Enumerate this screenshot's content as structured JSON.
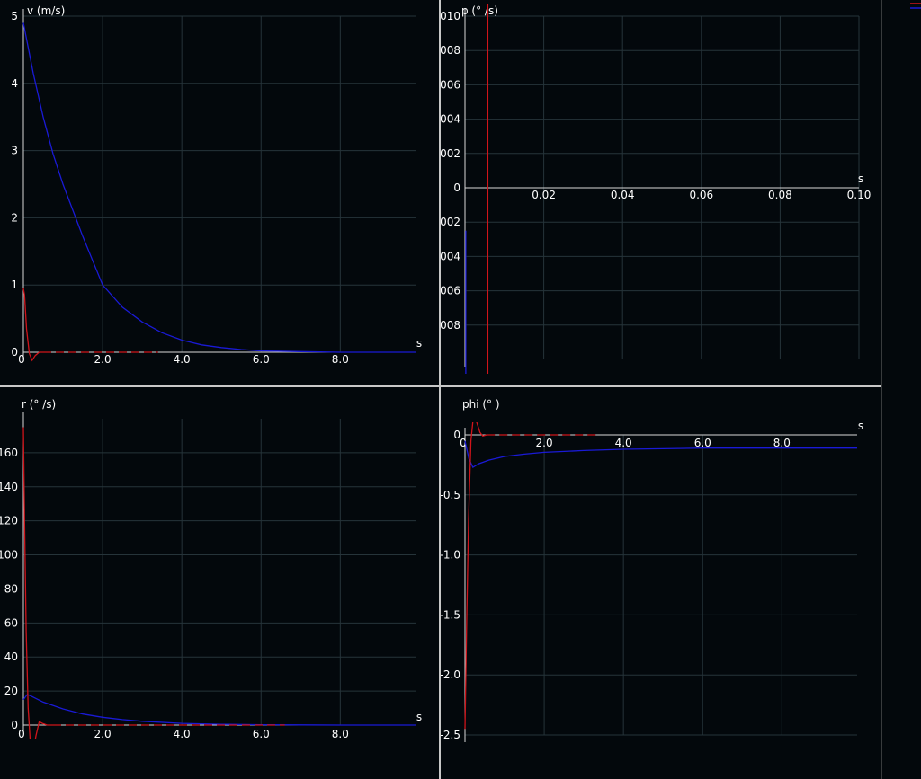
{
  "colors": {
    "background": "#03080c",
    "grid": "#26343a",
    "axis": "#d8d8d8",
    "divider": "#c8c8c8",
    "label": "#ffffff",
    "series_red": "#d0141a",
    "series_blue": "#1a1ad6"
  },
  "chart_data": [
    {
      "type": "line",
      "ylabel": "v (m/s)",
      "xlabel": "s",
      "xlim": [
        0,
        9.9
      ],
      "ylim": [
        0,
        5
      ],
      "xticks": [
        0,
        2,
        4,
        6,
        8
      ],
      "xtick_labels": [
        "0",
        "2.0",
        "4.0",
        "6.0",
        "8.0"
      ],
      "yticks": [
        0,
        1,
        2,
        3,
        4,
        5
      ],
      "ytick_labels": [
        "0",
        "1",
        "2",
        "3",
        "4",
        "5"
      ],
      "grid": true,
      "series": [
        {
          "color": "#1a1ad6",
          "style": "solid",
          "x": [
            0,
            0.25,
            0.5,
            0.75,
            1,
            1.5,
            2,
            2.5,
            3,
            3.5,
            4,
            4.5,
            5,
            5.5,
            6,
            7,
            8,
            9,
            9.9
          ],
          "y": [
            4.9,
            4.15,
            3.5,
            2.95,
            2.5,
            1.72,
            1.0,
            0.67,
            0.45,
            0.29,
            0.18,
            0.11,
            0.07,
            0.04,
            0.02,
            0.01,
            0.0,
            0.0,
            0.0
          ]
        },
        {
          "color": "#d0141a",
          "style": "solid",
          "x": [
            0,
            0.03,
            0.08,
            0.15,
            0.22,
            0.3,
            0.4,
            0.5
          ],
          "y": [
            0.95,
            0.85,
            0.35,
            -0.02,
            -0.12,
            -0.05,
            0.0,
            0.0
          ]
        },
        {
          "color": "#d0141a",
          "style": "dashed",
          "x": [
            0.5,
            3.4
          ],
          "y": [
            0.0,
            0.0
          ]
        }
      ]
    },
    {
      "type": "line",
      "ylabel": "p (° /s)",
      "xlabel": "s",
      "xlim": [
        0,
        0.1
      ],
      "ylim": [
        -0.01,
        0.01
      ],
      "xticks": [
        0.02,
        0.04,
        0.06,
        0.08,
        0.1
      ],
      "xtick_labels": [
        "0.02",
        "0.04",
        "0.06",
        "0.08",
        "0.10"
      ],
      "yticks": [
        0.01,
        0.008,
        0.006,
        0.004,
        0.002,
        0,
        -0.002,
        -0.004,
        -0.006,
        -0.008
      ],
      "ytick_labels": [
        "010",
        "008",
        "006",
        "004",
        "002",
        "0",
        "002",
        "004",
        "006",
        "008"
      ],
      "grid": true,
      "series": [
        {
          "color": "#d0141a",
          "style": "solid",
          "x": [
            0.0058,
            0.0058
          ],
          "y": [
            0.011,
            -0.0115
          ]
        },
        {
          "color": "#1a1ad6",
          "style": "solid",
          "x": [
            0.0002,
            0.0002
          ],
          "y": [
            -0.0025,
            -0.0115
          ]
        }
      ]
    },
    {
      "type": "line",
      "ylabel": "r (° /s)",
      "xlabel": "s",
      "xlim": [
        0,
        9.9
      ],
      "ylim": [
        0,
        180
      ],
      "xticks": [
        0,
        2,
        4,
        6,
        8
      ],
      "xtick_labels": [
        "0",
        "2.0",
        "4.0",
        "6.0",
        "8.0"
      ],
      "yticks": [
        0,
        20,
        40,
        60,
        80,
        100,
        120,
        140,
        160
      ],
      "ytick_labels": [
        "0",
        "20",
        "40",
        "60",
        "80",
        "100",
        "120",
        "140",
        "160"
      ],
      "grid": true,
      "series": [
        {
          "color": "#1a1ad6",
          "style": "solid",
          "x": [
            0,
            0.1,
            0.2,
            0.5,
            1,
            1.5,
            2,
            2.5,
            3,
            4,
            5,
            6,
            7,
            8,
            9,
            9.9
          ],
          "y": [
            15,
            18,
            17,
            13.5,
            9.5,
            6.5,
            4.6,
            3.2,
            2.2,
            1.0,
            0.5,
            0.2,
            0.1,
            0.0,
            0.0,
            0.0
          ]
        },
        {
          "color": "#d0141a",
          "style": "solid",
          "x": [
            0,
            0.03,
            0.07,
            0.12,
            0.18,
            0.25,
            0.32,
            0.4,
            0.48,
            0.6,
            0.75
          ],
          "y": [
            175,
            120,
            55,
            10,
            -12,
            -15,
            -6,
            2,
            1,
            0,
            0
          ]
        },
        {
          "color": "#d0141a",
          "style": "dashed",
          "x": [
            0.75,
            6.6
          ],
          "y": [
            0,
            0
          ]
        }
      ]
    },
    {
      "type": "line",
      "ylabel": "phi (° )",
      "xlabel": "s",
      "xlim": [
        0,
        9.9
      ],
      "ylim": [
        -2.5,
        0
      ],
      "xticks": [
        0,
        2,
        4,
        6,
        8
      ],
      "xtick_labels": [
        "0",
        "2.0",
        "4.0",
        "6.0",
        "8.0"
      ],
      "yticks": [
        0,
        -0.5,
        -1.0,
        -1.5,
        -2.0,
        -2.5
      ],
      "ytick_labels": [
        "0",
        "-0.5",
        "-1.0",
        "-1.5",
        "-2.0",
        "-2.5"
      ],
      "grid": true,
      "series": [
        {
          "color": "#1a1ad6",
          "style": "solid",
          "x": [
            0,
            0.1,
            0.2,
            0.35,
            0.6,
            1,
            1.5,
            2,
            3,
            4,
            5,
            6,
            7,
            8,
            9,
            9.9
          ],
          "y": [
            -0.05,
            -0.2,
            -0.27,
            -0.24,
            -0.21,
            -0.18,
            -0.16,
            -0.145,
            -0.13,
            -0.12,
            -0.115,
            -0.11,
            -0.11,
            -0.11,
            -0.11,
            -0.11
          ]
        },
        {
          "color": "#d0141a",
          "style": "solid",
          "x": [
            0,
            0.04,
            0.09,
            0.15,
            0.22,
            0.3,
            0.38,
            0.45,
            0.55
          ],
          "y": [
            -2.45,
            -1.6,
            -0.7,
            -0.05,
            0.18,
            0.1,
            0.02,
            -0.01,
            0.0
          ]
        },
        {
          "color": "#d0141a",
          "style": "dashed",
          "x": [
            0.55,
            3.4
          ],
          "y": [
            0,
            0
          ]
        }
      ]
    }
  ]
}
